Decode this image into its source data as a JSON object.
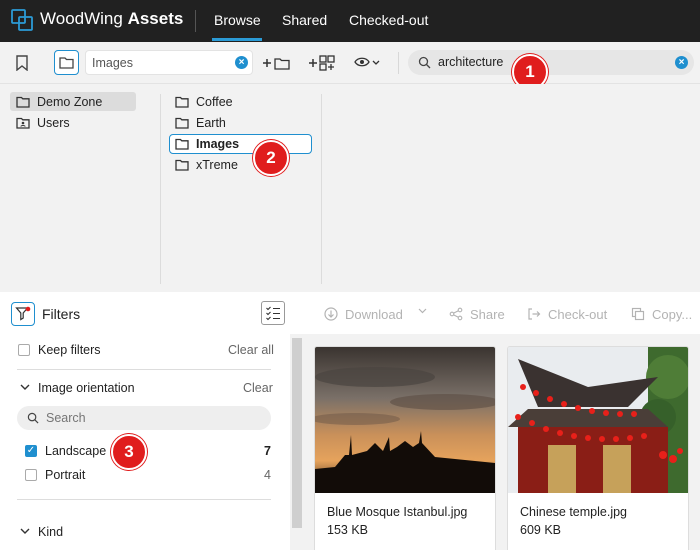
{
  "app": {
    "brand_light": "WoodWing ",
    "brand_bold": "Assets",
    "tabs": [
      {
        "label": "Browse",
        "active": true
      },
      {
        "label": "Shared",
        "active": false
      },
      {
        "label": "Checked-out",
        "active": false
      }
    ]
  },
  "toolbar": {
    "path_value": "Images",
    "search_value": "architecture",
    "icons": [
      "bookmark-icon",
      "folder-icon",
      "new-folder-icon",
      "add-items-icon",
      "view-options-icon"
    ]
  },
  "tree": {
    "root": [
      {
        "label": "Demo Zone",
        "selected": true
      },
      {
        "label": "Users",
        "selected": false
      }
    ],
    "folders": [
      {
        "label": "Coffee",
        "selected": false
      },
      {
        "label": "Earth",
        "selected": false
      },
      {
        "label": "Images",
        "selected": true
      },
      {
        "label": "xTreme",
        "selected": false
      }
    ]
  },
  "callouts": [
    "1",
    "2",
    "3"
  ],
  "filters": {
    "title": "Filters",
    "keep_filters": "Keep filters",
    "clear_all": "Clear all",
    "image_orientation": {
      "title": "Image orientation",
      "clear": "Clear",
      "search_placeholder": "Search",
      "options": [
        {
          "label": "Landscape",
          "count": "7",
          "checked": true
        },
        {
          "label": "Portrait",
          "count": "4",
          "checked": false
        }
      ]
    },
    "kind": {
      "title": "Kind"
    }
  },
  "actions": [
    {
      "label": "Download",
      "icon": "download-icon"
    },
    {
      "label": "Share",
      "icon": "share-icon"
    },
    {
      "label": "Check-out",
      "icon": "checkout-icon"
    },
    {
      "label": "Copy...",
      "icon": "copy-icon"
    }
  ],
  "results": [
    {
      "name": "Blue Mosque Istanbul.jpg",
      "size": "153 KB"
    },
    {
      "name": "Chinese temple.jpg",
      "size": "609 KB"
    }
  ],
  "colors": {
    "accent": "#1f8fcf",
    "nav_bg": "#212121",
    "callout": "#e01d1d"
  }
}
